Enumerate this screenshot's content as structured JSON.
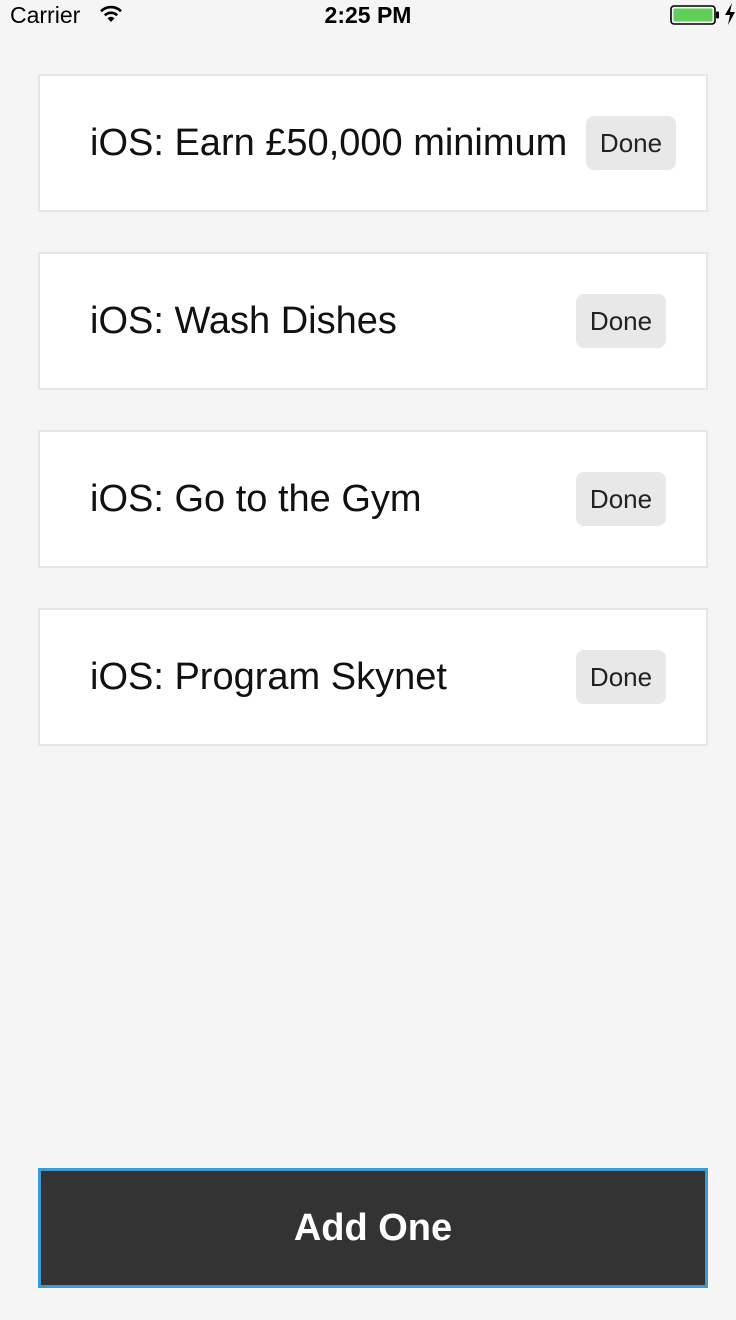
{
  "status_bar": {
    "carrier": "Carrier",
    "time": "2:25 PM",
    "battery_color": "#5fcf5a"
  },
  "todos": [
    {
      "text": "iOS: Earn £50,000 minimum",
      "button_label": "Done"
    },
    {
      "text": "iOS: Wash Dishes",
      "button_label": "Done"
    },
    {
      "text": "iOS: Go to the Gym",
      "button_label": "Done"
    },
    {
      "text": "iOS: Program Skynet",
      "button_label": "Done"
    }
  ],
  "add_button": {
    "label": "Add One",
    "background": "#333333",
    "border": "#3a9bd6"
  },
  "icons": {
    "wifi": "wifi-icon",
    "battery": "battery-icon",
    "charging": "charging-bolt-icon"
  }
}
